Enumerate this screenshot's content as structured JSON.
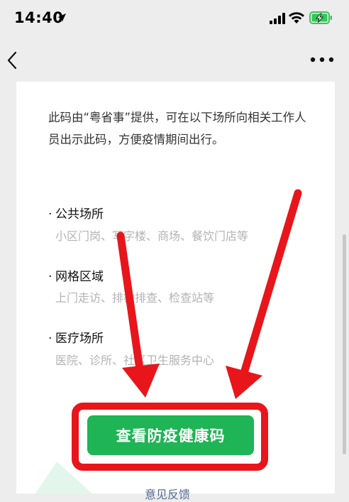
{
  "status_bar": {
    "time": "14:40",
    "icons": [
      "location-arrow-icon",
      "cellular-signal-icon",
      "wifi-icon",
      "battery-charging-icon"
    ]
  },
  "nav": {
    "back_icon": "chevron-left-icon",
    "more_icon": "more-dots-icon"
  },
  "content": {
    "intro": "此码由“粤省事”提供，可在以下场所向相关工作人员出示此码，方便疫情期间出行。",
    "sections": [
      {
        "title": "公共场所",
        "desc": "小区门岗、写字楼、商场、餐饮门店等"
      },
      {
        "title": "网格区域",
        "desc": "上门走访、排检排查、检查站等"
      },
      {
        "title": "医疗场所",
        "desc": "医院、诊所、社区卫生服务中心"
      }
    ]
  },
  "primary_button": {
    "label": "查看防疫健康码"
  },
  "feedback": {
    "label": "意见反馈"
  },
  "colors": {
    "accent_green": "#1fb455",
    "annotation_red": "#e8151b",
    "link_blue": "#576b95",
    "battery_green": "#34c759"
  }
}
